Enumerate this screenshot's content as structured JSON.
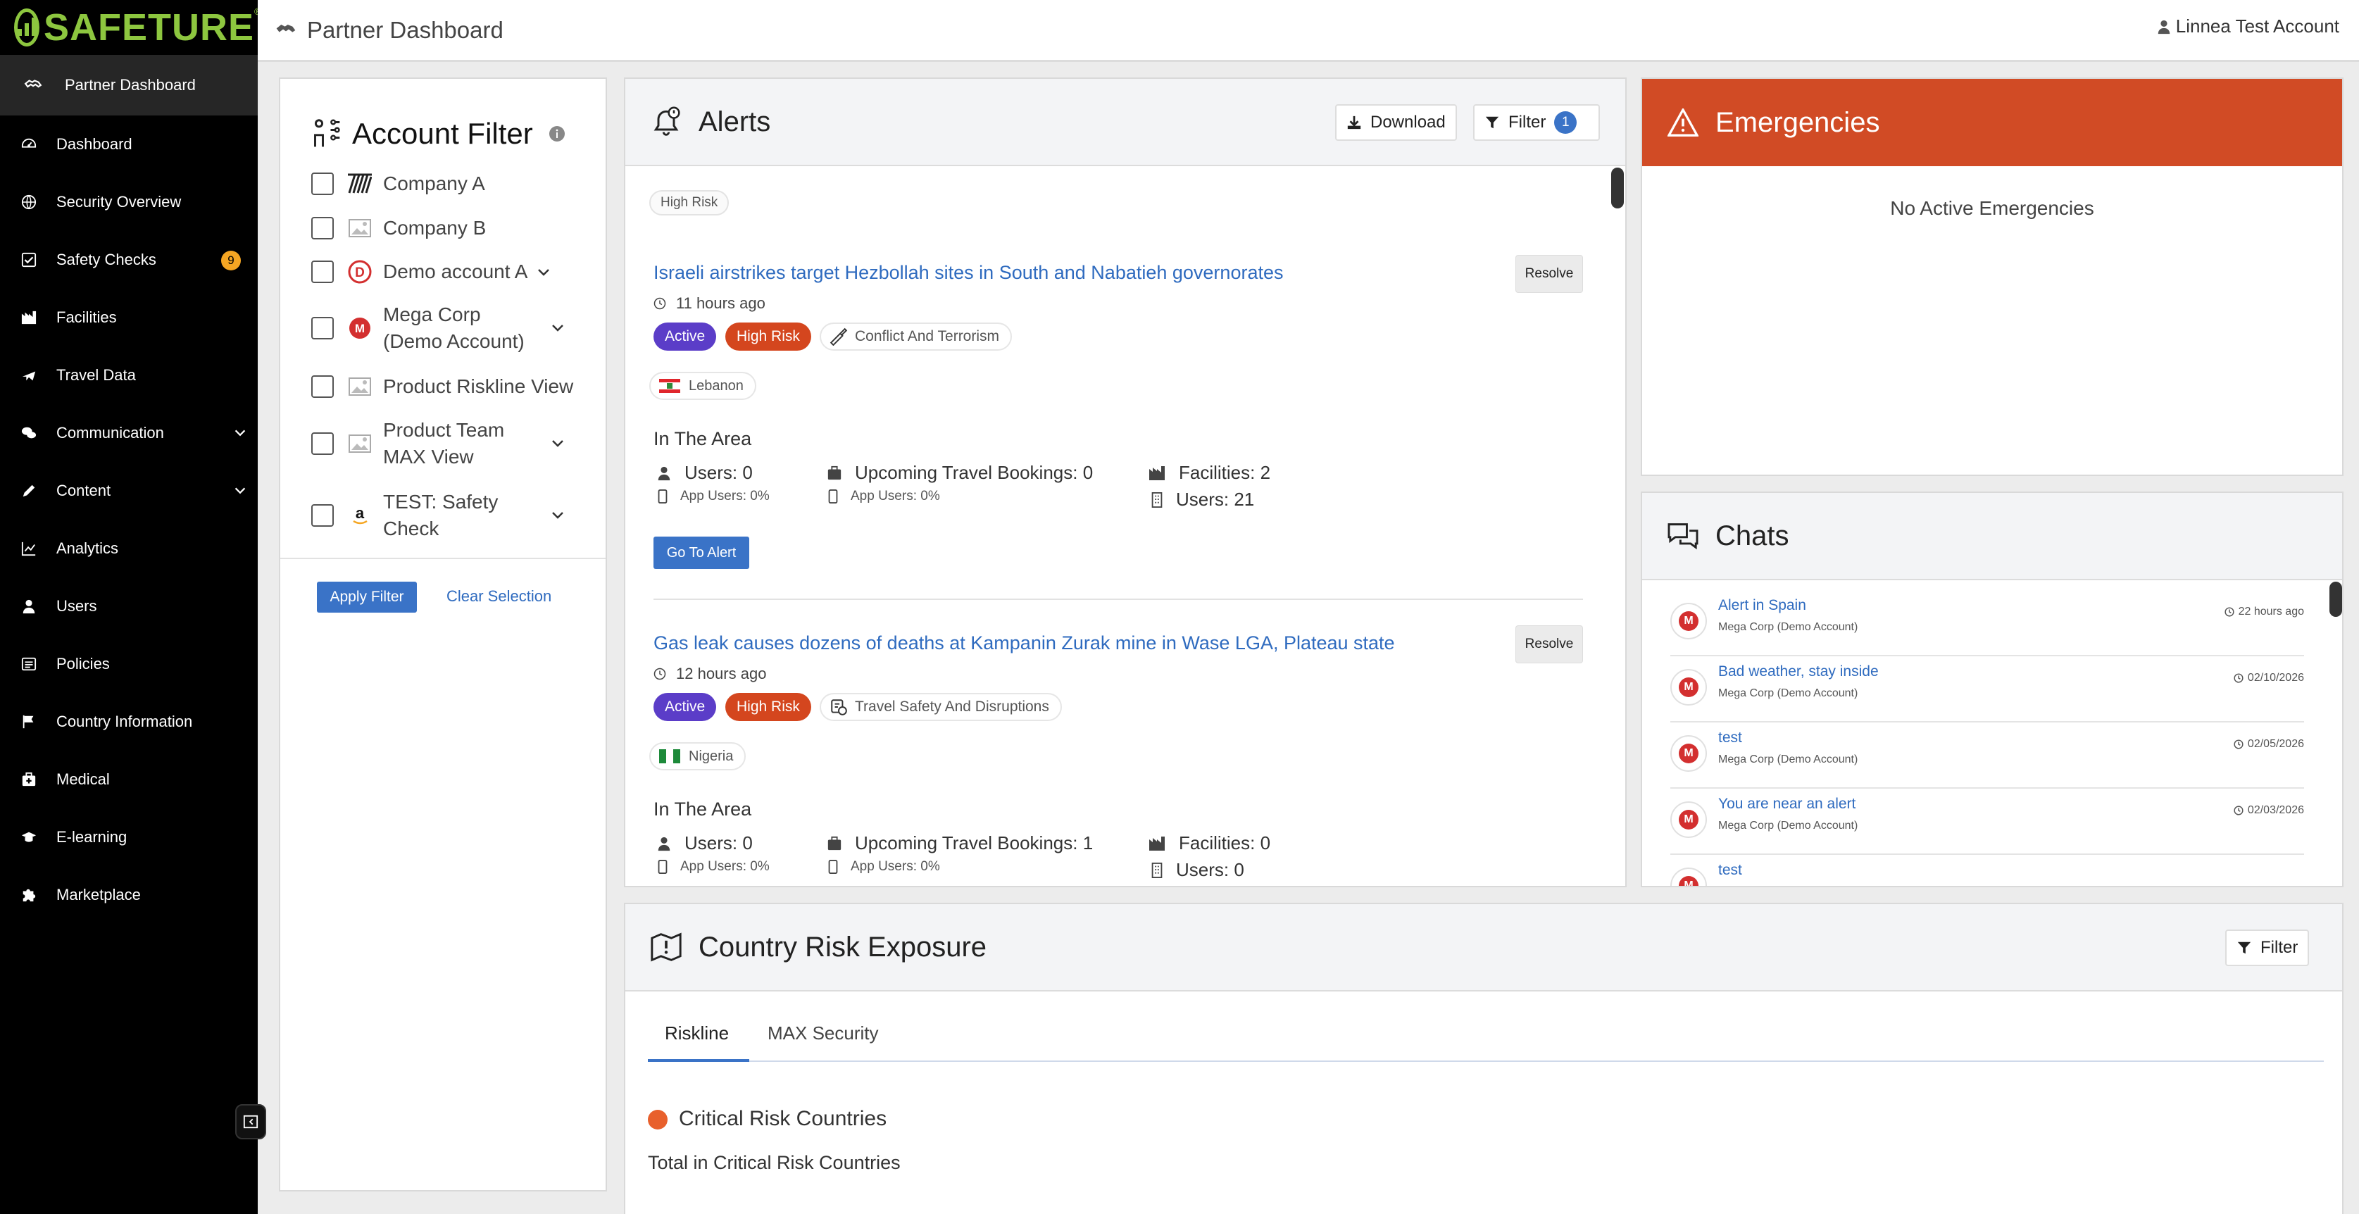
{
  "brand": {
    "name": "SAFETURE",
    "registered": "®",
    "accent": "#8dc63f"
  },
  "sidebar": {
    "active": "Partner Dashboard",
    "items": [
      {
        "label": "Dashboard",
        "icon": "dashboard-icon"
      },
      {
        "label": "Security Overview",
        "icon": "globe-icon"
      },
      {
        "label": "Safety Checks",
        "icon": "checkbox-icon",
        "badge": "9"
      },
      {
        "label": "Facilities",
        "icon": "factory-icon"
      },
      {
        "label": "Travel Data",
        "icon": "plane-icon"
      },
      {
        "label": "Communication",
        "icon": "comments-icon",
        "expandable": true
      },
      {
        "label": "Content",
        "icon": "pencil-icon",
        "expandable": true
      },
      {
        "label": "Analytics",
        "icon": "chart-icon"
      },
      {
        "label": "Users",
        "icon": "user-icon"
      },
      {
        "label": "Policies",
        "icon": "list-icon"
      },
      {
        "label": "Country Information",
        "icon": "flag-icon"
      },
      {
        "label": "Medical",
        "icon": "medical-kit-icon"
      },
      {
        "label": "E-learning",
        "icon": "graduation-cap-icon"
      },
      {
        "label": "Marketplace",
        "icon": "puzzle-icon"
      }
    ]
  },
  "header": {
    "title": "Partner Dashboard",
    "user": "Linnea Test Account"
  },
  "account_filter": {
    "title": "Account Filter",
    "accounts": [
      {
        "name": "Company A"
      },
      {
        "name": "Company B"
      },
      {
        "name": "Demo account A"
      },
      {
        "name": "Mega Corp (Demo Account)"
      },
      {
        "name": "Product Riskline View"
      },
      {
        "name": "Product Team MAX View"
      },
      {
        "name": "TEST: Safety Check"
      }
    ],
    "apply_label": "Apply Filter",
    "clear_label": "Clear Selection"
  },
  "alerts": {
    "title": "Alerts",
    "download_label": "Download",
    "filter_label": "Filter",
    "filter_count": "1",
    "filter_chip": "High Risk",
    "items": [
      {
        "title": "Israeli airstrikes target Hezbollah sites in South and Nabatieh governorates",
        "time": "11 hours ago",
        "status": "Active",
        "risk": "High Risk",
        "category": "Conflict And Terrorism",
        "country": "Lebanon",
        "section": "In The Area",
        "users": "Users: 0",
        "users_app": "App Users: 0%",
        "bookings": "Upcoming Travel Bookings: 0",
        "bookings_app": "App Users: 0%",
        "facilities": "Facilities: 2",
        "facility_users": "Users: 21",
        "resolve": "Resolve",
        "goto": "Go To Alert"
      },
      {
        "title": "Gas leak causes dozens of deaths at Kampanin Zurak mine in Wase LGA, Plateau state",
        "time": "12 hours ago",
        "status": "Active",
        "risk": "High Risk",
        "category": "Travel Safety And Disruptions",
        "country": "Nigeria",
        "section": "In The Area",
        "users": "Users: 0",
        "users_app": "App Users: 0%",
        "bookings": "Upcoming Travel Bookings: 1",
        "bookings_app": "App Users: 0%",
        "facilities": "Facilities: 0",
        "facility_users": "Users: 0",
        "resolve": "Resolve"
      }
    ]
  },
  "emergencies": {
    "title": "Emergencies",
    "empty": "No Active Emergencies",
    "color": "#d14b25"
  },
  "chats": {
    "title": "Chats",
    "items": [
      {
        "title": "Alert in Spain",
        "sub": "Mega Corp (Demo Account)",
        "date": "22 hours ago"
      },
      {
        "title": "Bad weather, stay inside",
        "sub": "Mega Corp (Demo Account)",
        "date": "02/10/2026"
      },
      {
        "title": "test",
        "sub": "Mega Corp (Demo Account)",
        "date": "02/05/2026"
      },
      {
        "title": "You are near an alert",
        "sub": "Mega Corp (Demo Account)",
        "date": "02/03/2026"
      },
      {
        "title": "test",
        "sub": "",
        "date": ""
      }
    ]
  },
  "country_risk": {
    "title": "Country Risk Exposure",
    "filter_label": "Filter",
    "tabs": [
      "Riskline",
      "MAX Security"
    ],
    "active_tab": "Riskline",
    "critical_title": "Critical Risk Countries",
    "critical_total": "Total in Critical Risk Countries"
  }
}
